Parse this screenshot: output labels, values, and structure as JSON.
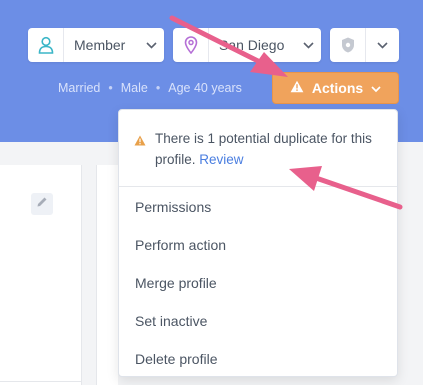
{
  "header": {
    "member_select": {
      "value": "Member",
      "icon": "user-icon"
    },
    "location_select": {
      "value": "San Diego",
      "icon": "map-pin-icon"
    },
    "badge_select": {
      "icon": "shield-icon"
    },
    "meta": {
      "marital": "Married",
      "sex": "Male",
      "age": "Age 40 years",
      "separator": "•"
    },
    "actions_label": "Actions"
  },
  "dropdown": {
    "duplicate_notice": {
      "text": "There is 1 potential duplicate for this profile.",
      "link": "Review"
    },
    "items": [
      {
        "label": "Permissions"
      },
      {
        "label": "Perform action"
      },
      {
        "label": "Merge profile"
      },
      {
        "label": "Set inactive"
      },
      {
        "label": "Delete profile"
      }
    ]
  },
  "colors": {
    "header_bg": "#6c8ee6",
    "actions_bg": "#f0a35c",
    "link": "#4a7ee0",
    "arrow": "#e8608c",
    "warning": "#e8a04a"
  }
}
